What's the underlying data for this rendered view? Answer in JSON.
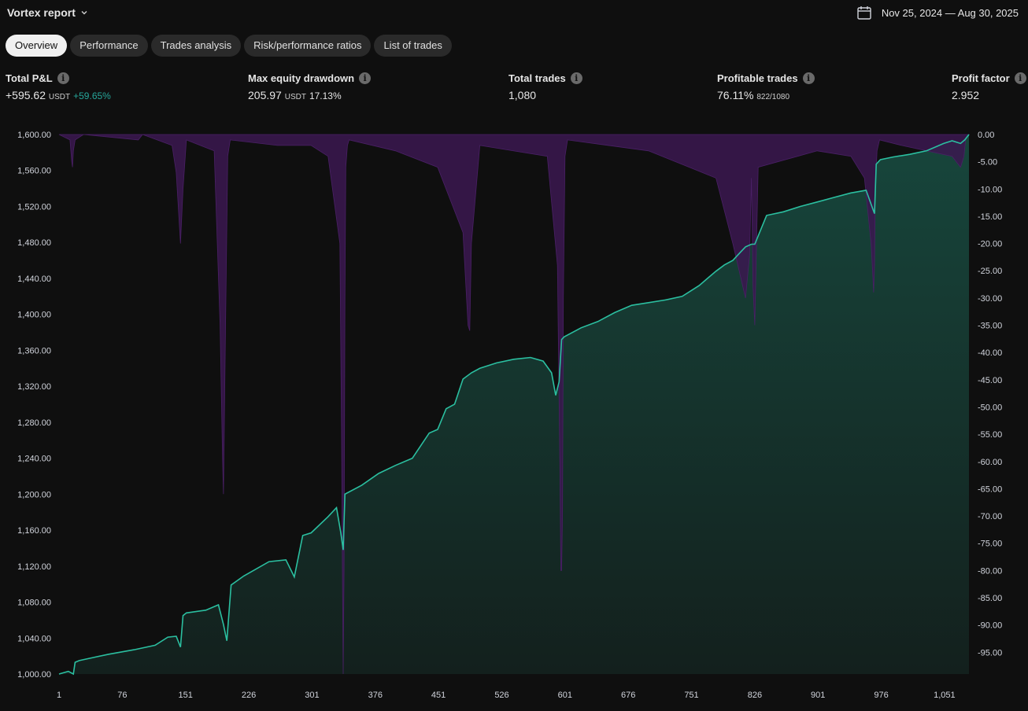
{
  "header": {
    "report_title": "Vortex report",
    "date_range": "Nov 25, 2024 — Aug 30, 2025",
    "calendar_icon": "calendar-icon"
  },
  "tabs": [
    {
      "label": "Overview",
      "active": true
    },
    {
      "label": "Performance",
      "active": false
    },
    {
      "label": "Trades analysis",
      "active": false
    },
    {
      "label": "Risk/performance ratios",
      "active": false
    },
    {
      "label": "List of trades",
      "active": false
    }
  ],
  "metrics": {
    "total_pnl": {
      "label": "Total P&L",
      "value": "+595.62",
      "unit": "USDT",
      "pct": "+59.65%"
    },
    "max_drawdown": {
      "label": "Max equity drawdown",
      "value": "205.97",
      "unit": "USDT",
      "pct": "17.13%"
    },
    "total_trades": {
      "label": "Total trades",
      "value": "1,080"
    },
    "profitable_trades": {
      "label": "Profitable trades",
      "value": "76.11%",
      "detail": "822/1080"
    },
    "profit_factor": {
      "label": "Profit factor",
      "value": "2.952"
    }
  },
  "colors": {
    "equity_line": "#2bbfa0",
    "equity_fill": "#17463c",
    "drawdown": "#3b1850",
    "positive": "#26a69a"
  },
  "chart_data": {
    "type": "area",
    "x_ticks": [
      "1",
      "76",
      "151",
      "226",
      "301",
      "376",
      "451",
      "526",
      "601",
      "676",
      "751",
      "826",
      "901",
      "976",
      "1,051"
    ],
    "x_tick_values": [
      1,
      76,
      151,
      226,
      301,
      376,
      451,
      526,
      601,
      676,
      751,
      826,
      901,
      976,
      1051
    ],
    "xlim": [
      1,
      1080
    ],
    "left_axis": {
      "ylim": [
        1000,
        1600
      ],
      "ticks": [
        "1,000.00",
        "1,040.00",
        "1,080.00",
        "1,120.00",
        "1,160.00",
        "1,200.00",
        "1,240.00",
        "1,280.00",
        "1,320.00",
        "1,360.00",
        "1,400.00",
        "1,440.00",
        "1,480.00",
        "1,520.00",
        "1,560.00",
        "1,600.00"
      ],
      "tick_values": [
        1000,
        1040,
        1080,
        1120,
        1160,
        1200,
        1240,
        1280,
        1320,
        1360,
        1400,
        1440,
        1480,
        1520,
        1560,
        1600
      ]
    },
    "right_axis": {
      "ylim": [
        -99,
        0
      ],
      "ticks": [
        "0.00",
        "-5.00",
        "-10.00",
        "-15.00",
        "-20.00",
        "-25.00",
        "-30.00",
        "-35.00",
        "-40.00",
        "-45.00",
        "-50.00",
        "-55.00",
        "-60.00",
        "-65.00",
        "-70.00",
        "-75.00",
        "-80.00",
        "-85.00",
        "-90.00",
        "-95.00"
      ],
      "tick_values": [
        0,
        -5,
        -10,
        -15,
        -20,
        -25,
        -30,
        -35,
        -40,
        -45,
        -50,
        -55,
        -60,
        -65,
        -70,
        -75,
        -80,
        -85,
        -90,
        -95
      ]
    },
    "series": [
      {
        "axis": "left",
        "x": [
          1,
          12,
          18,
          20,
          25,
          40,
          60,
          90,
          115,
          130,
          140,
          145,
          148,
          152,
          175,
          190,
          196,
          200,
          205,
          220,
          250,
          270,
          280,
          290,
          300,
          320,
          330,
          335,
          338,
          340,
          360,
          380,
          400,
          420,
          440,
          450,
          460,
          470,
          480,
          490,
          500,
          520,
          540,
          560,
          575,
          585,
          590,
          594,
          597,
          600,
          620,
          640,
          660,
          680,
          700,
          720,
          740,
          760,
          770,
          780,
          790,
          800,
          810,
          815,
          822,
          826,
          840,
          860,
          880,
          900,
          920,
          940,
          958,
          968,
          970,
          975,
          990,
          1010,
          1030,
          1050,
          1060,
          1070,
          1075,
          1080
        ],
        "y": [
          1000,
          1003,
          1000,
          1013,
          1015,
          1018,
          1022,
          1027,
          1032,
          1041,
          1042,
          1030,
          1065,
          1068,
          1071,
          1077,
          1055,
          1037,
          1099,
          1109,
          1125,
          1127,
          1108,
          1154,
          1157,
          1175,
          1185,
          1158,
          1138,
          1200,
          1210,
          1223,
          1232,
          1240,
          1268,
          1272,
          1295,
          1300,
          1328,
          1335,
          1340,
          1346,
          1350,
          1352,
          1348,
          1335,
          1310,
          1325,
          1372,
          1375,
          1385,
          1392,
          1402,
          1410,
          1413,
          1416,
          1420,
          1432,
          1440,
          1448,
          1455,
          1460,
          1470,
          1475,
          1478,
          1478,
          1510,
          1514,
          1520,
          1525,
          1530,
          1535,
          1538,
          1512,
          1567,
          1572,
          1575,
          1578,
          1582,
          1590,
          1593,
          1590,
          1594,
          1600
        ]
      },
      {
        "axis": "right",
        "x": [
          1,
          14,
          16,
          17,
          18,
          20,
          30,
          95,
          100,
          135,
          140,
          145,
          148,
          152,
          185,
          192,
          195,
          196,
          198,
          201,
          204,
          260,
          300,
          320,
          334,
          336,
          337,
          338,
          339,
          340,
          341,
          343,
          345,
          400,
          450,
          480,
          486,
          488,
          490,
          500,
          580,
          592,
          595,
          596,
          597,
          598,
          599,
          601,
          604,
          700,
          780,
          800,
          815,
          820,
          822,
          824,
          826,
          830,
          900,
          940,
          956,
          964,
          966,
          967,
          968,
          969,
          971,
          974,
          1000,
          1060,
          1070,
          1074,
          1076,
          1080
        ],
        "y": [
          0,
          -1,
          -5,
          -6,
          -3,
          -1,
          0,
          -1,
          0,
          -2,
          -7,
          -20,
          -10,
          -1,
          -3,
          -35,
          -60,
          -66,
          -40,
          -4,
          -1,
          -2,
          -2,
          -4,
          -20,
          -55,
          -80,
          -99,
          -80,
          -30,
          -6,
          -2,
          -1,
          -3,
          -6,
          -18,
          -35,
          -36,
          -20,
          -2,
          -4,
          -24,
          -62,
          -80,
          -80,
          -70,
          -30,
          -4,
          -1,
          -3,
          -8,
          -20,
          -30,
          -22,
          -8,
          -28,
          -35,
          -6,
          -3,
          -4,
          -8,
          -20,
          -26,
          -29,
          -24,
          -10,
          -3,
          -1,
          -2,
          -4,
          -6,
          -4,
          -1,
          0
        ]
      }
    ]
  }
}
